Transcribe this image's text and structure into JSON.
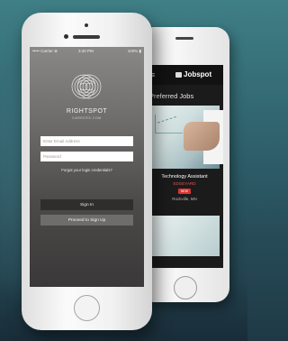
{
  "front_phone": {
    "status_bar": {
      "carrier": "••••• Carrier ⊗",
      "time": "3:40 PM",
      "battery": "100% ▮"
    },
    "brand_name": "RIGHTSPOT",
    "brand_tagline": "CAREERS.COM",
    "email_placeholder": "Enter Email Address",
    "password_placeholder": "Password",
    "forgot_link": "Forgot your login credentials?",
    "signin_label": "Sign In",
    "signup_label": "Proceed to Sign Up"
  },
  "back_phone": {
    "menu_icon": "≡",
    "brand": "Jobspot",
    "section_title": "Preferred Jobs",
    "job": {
      "title": "Technology Assistant",
      "company": "EDGEYARD",
      "badge": "NEW",
      "location": "Rockville, MN"
    }
  },
  "colors": {
    "background": "#2e5f6a",
    "screen": "#6b6968",
    "signin_button": "#2f2d2d",
    "signup_button": "#6f6d6c",
    "back_screen": "#1b1b1b",
    "badge": "#dd3333"
  },
  "icons": [
    "fingerprint-logo-icon",
    "menu-icon",
    "briefcase-icon",
    "home-button-icon"
  ]
}
